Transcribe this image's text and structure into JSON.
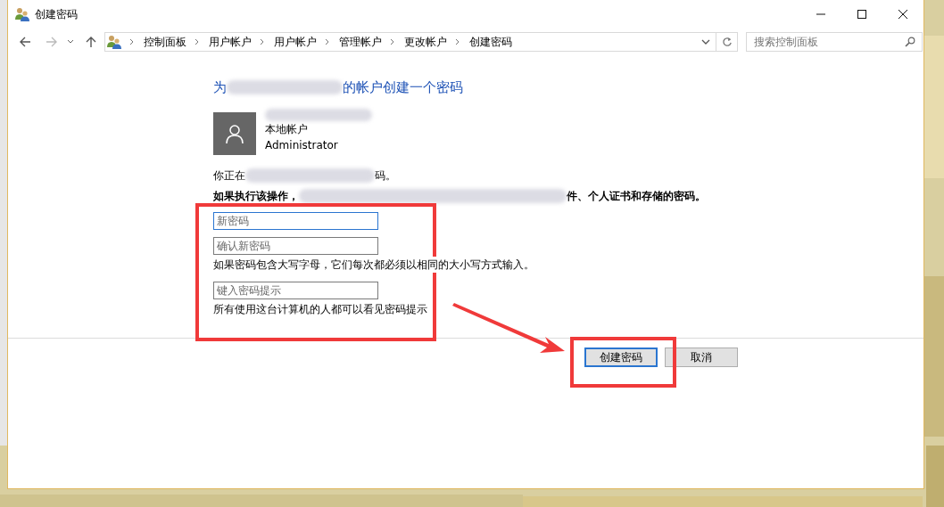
{
  "window": {
    "title": "创建密码"
  },
  "address_bar": {
    "path": [
      "控制面板",
      "用户帐户",
      "用户帐户",
      "管理帐户",
      "更改帐户",
      "创建密码"
    ]
  },
  "search": {
    "placeholder": "搜索控制面板"
  },
  "heading_parts": [
    "为",
    "的帐户创建一个密码"
  ],
  "account": {
    "type": "本地帐户",
    "role": "Administrator"
  },
  "notice_parts": [
    "你正在",
    "码。"
  ],
  "warning_parts": [
    "如果执行该操作，",
    "件、个人证书和存储的密码。"
  ],
  "fields": [
    {
      "placeholder": "新密码",
      "focused": true
    },
    {
      "placeholder": "确认新密码",
      "focused": false,
      "note": "如果密码包含大写字母，它们每次都必须以相同的大小写方式输入。"
    },
    {
      "placeholder": "键入密码提示",
      "focused": false,
      "note": "所有使用这台计算机的人都可以看见密码提示"
    }
  ],
  "buttons": [
    {
      "label": "创建密码",
      "default": true
    },
    {
      "label": "取消",
      "default": false
    }
  ]
}
